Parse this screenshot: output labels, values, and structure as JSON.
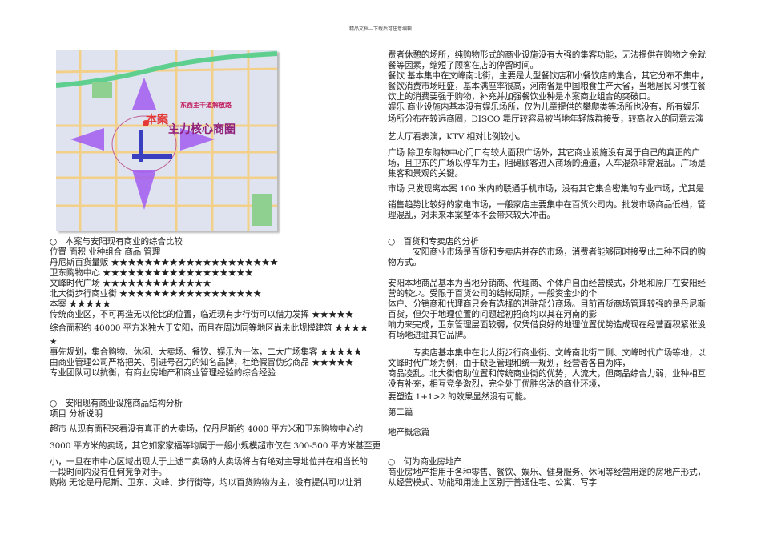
{
  "header": "精品文档---下载后可任意编辑",
  "map": {
    "labels": {
      "site": "本案",
      "core": "主力核心商圈",
      "road": "东西主干道解放路"
    },
    "colors": {
      "background": "#dfe3ef",
      "road": "#f3d08a",
      "arrow": "#a25cf0",
      "label": "#c2185b",
      "site": "#e53935",
      "park": "#8fcf8f"
    }
  },
  "left": [
    "○　本案与安阳现有商业的综合比较",
    "位置  面积  业种组合  商品  管理",
    "丹尼斯百货量贩 ★★★★★★★★★★★★★★★★★★★★",
    "卫东购物中心 ★★★★★★★★★★★★★★★★★★",
    "文峰时代广场 ★★★★★★★★★★★★★",
    "北大街步行商业街 ★★★★★★★★★★★★★★★★★",
    "本案 ★★★★★",
    "传统商业区，不可再造无以伦比的位置，临近现有步行街可以借力发挥 ★★★★★",
    "综合面积约 40000 平方米独大于安阳，而且在周边同等地区尚未此规模建筑 ★★★★",
    "★",
    "事先规划，集合购物、休闲、大卖场、餐饮、娱乐为一体，二大广场集客 ★★★★★",
    "由商业管理公司严格把关、引进号召力的知名品牌，杜绝假冒伪劣商品 ★★★★★",
    "专业团队可以抗衡，有商业房地产和商业管理经验的综合经验",
    "○　安阳现有商业设施商品结构分析",
    "项目  分析说明",
    "超市  从现有面积来看没有真正的大卖场，仅丹尼斯约 4000 平方米和卫东购物中心约",
    "3000 平方米的卖场，其它如家家福等均属于一般小规模超市仅在 300-500 平方米甚至更",
    "小，一旦在市中心区域出现大于上述二卖场的大卖场将占有绝对主导地位并在相当长的",
    "一段时间内没有任何竞争对手。",
    "购物  无论是丹尼斯、卫东、文峰、步行街等，均以百货购物为主，没有提供可以让消"
  ],
  "right": [
    "费者休憩的场所，纯购物形式的商业设施没有大强的集客功能，无法提供在购物之余就",
    "餐等因素，缩短了顾客在店的停留时间。",
    "餐饮  基本集中在文峰南北街，主要是大型餐饮店和小餐饮店的集合，其它分布不集中，",
    "餐饮消费市场旺盛，基本满座率很高，河南省是中国粮食生产大省，当地居民习惯在餐",
    "饮上的消费要强于购物，补充并加强餐饮业种是本案商业组合的突破口。",
    "娱乐  商业设施内基本没有娱乐场所，仅为儿童提供的攀爬类等场所也没有，所有娱乐",
    "场所分布在较远商圈，DISCO 舞厅较容易被当地年轻族群接受，较高收入的同意去演",
    "艺大厅看表演，KTV 相对比例较小。",
    "广场  除卫东购物中心门口有较大面积广场外，其它商业设施没有属于自己的真正的广",
    "场，且卫东的广场以停车为主，阻碍顾客进入商场的通道，人车混杂非常混乱。广场是",
    "集客和景观的关键。",
    "市场  只发现离本案 100 米内的联通手机市场，没有其它集合密集的专业市场，尤其是",
    "销售趋势比较好的家电市场，一般家店主要集中在百货公司内。批发市场商品低档，管",
    "理混乱，对未来本案整体不会带来较大冲击。",
    "○　百货和专卖店的分析",
    "　　　安阳商业市场是百货和专卖店并存的市场，消费者能够同时接受此二种不同的购",
    "物方式。",
    "安阳本地商品基本为当地分销商、代理商、个体户自由经营模式，外地和原厂在安阳经",
    "营的较少。受限于百货公司的结帐周期，一般资金少的个",
    "体户、分销商和代理商只会有选择的进驻部分商场。目前百货商场管理较强的是丹尼斯",
    "百货，但欠于地理位置的问题起初招商均以其在河南的影",
    "响力来完成，卫东管理层面较弱，仅凭借良好的地理位置优势造成现在经营面积紧张没",
    "有场地进驻其它品牌。",
    "　　　专卖店基本集中在北大街步行商业街、文峰南北街二侧、文峰时代广场等地，以",
    "文峰时代广场为例，由于缺乏管理和统一规划，经营者各自为阵，",
    "商品凌乱。北大街借助位置和传统商业街的优势，人流大，但商品综合力弱，业种相互",
    "没有补充，相互竞争激烈，完全处于优胜劣汰的商业环境，",
    "要塑造 1+1>2 的效果显然没有可能。",
    "第二篇",
    "地产概念篇",
    "○　何为商业房地产",
    "商业房地产指用于各种零售、餐饮、娱乐、健身服务、休闲等经营用途的房地产形式，",
    "从经营模式、功能和用途上区别于普通住宅、公寓、写字"
  ]
}
